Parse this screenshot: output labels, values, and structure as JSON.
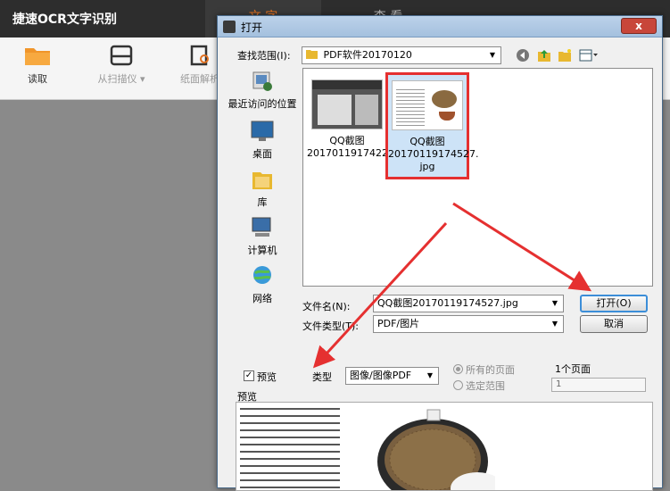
{
  "app": {
    "title": "捷速OCR文字识别",
    "tabs": [
      "文  字",
      "查  看"
    ],
    "toolbar": [
      {
        "label": "读取",
        "icon": "folder-icon"
      },
      {
        "label": "从扫描仪 ▾",
        "icon": "scanner-icon"
      },
      {
        "label": "纸面解析",
        "icon": "page-parse-icon"
      }
    ]
  },
  "dialog": {
    "title": "打开",
    "close_label": "x",
    "look_in_label": "查找范围(I):",
    "look_in_value": "PDF软件20170120",
    "places": [
      "最近访问的位置",
      "桌面",
      "库",
      "计算机",
      "网络"
    ],
    "files": [
      {
        "name": "QQ截图\n2017011917422...",
        "selected": false
      },
      {
        "name": "QQ截图\n20170119174527.\njpg",
        "selected": true
      }
    ],
    "filename_label": "文件名(N):",
    "filename_value": "QQ截图20170119174527.jpg",
    "filetype_label": "文件类型(T):",
    "filetype_value": "PDF/图片",
    "open_button": "打开(O)",
    "cancel_button": "取消",
    "preview_checkbox": "预览",
    "preview_checked": true,
    "type_label": "类型",
    "type_value": "图像/图像PDF",
    "all_pages": "所有的页面",
    "selected_range": "选定范围",
    "page_count": "1个页面",
    "page_input": "1",
    "preview_label": "预览"
  }
}
